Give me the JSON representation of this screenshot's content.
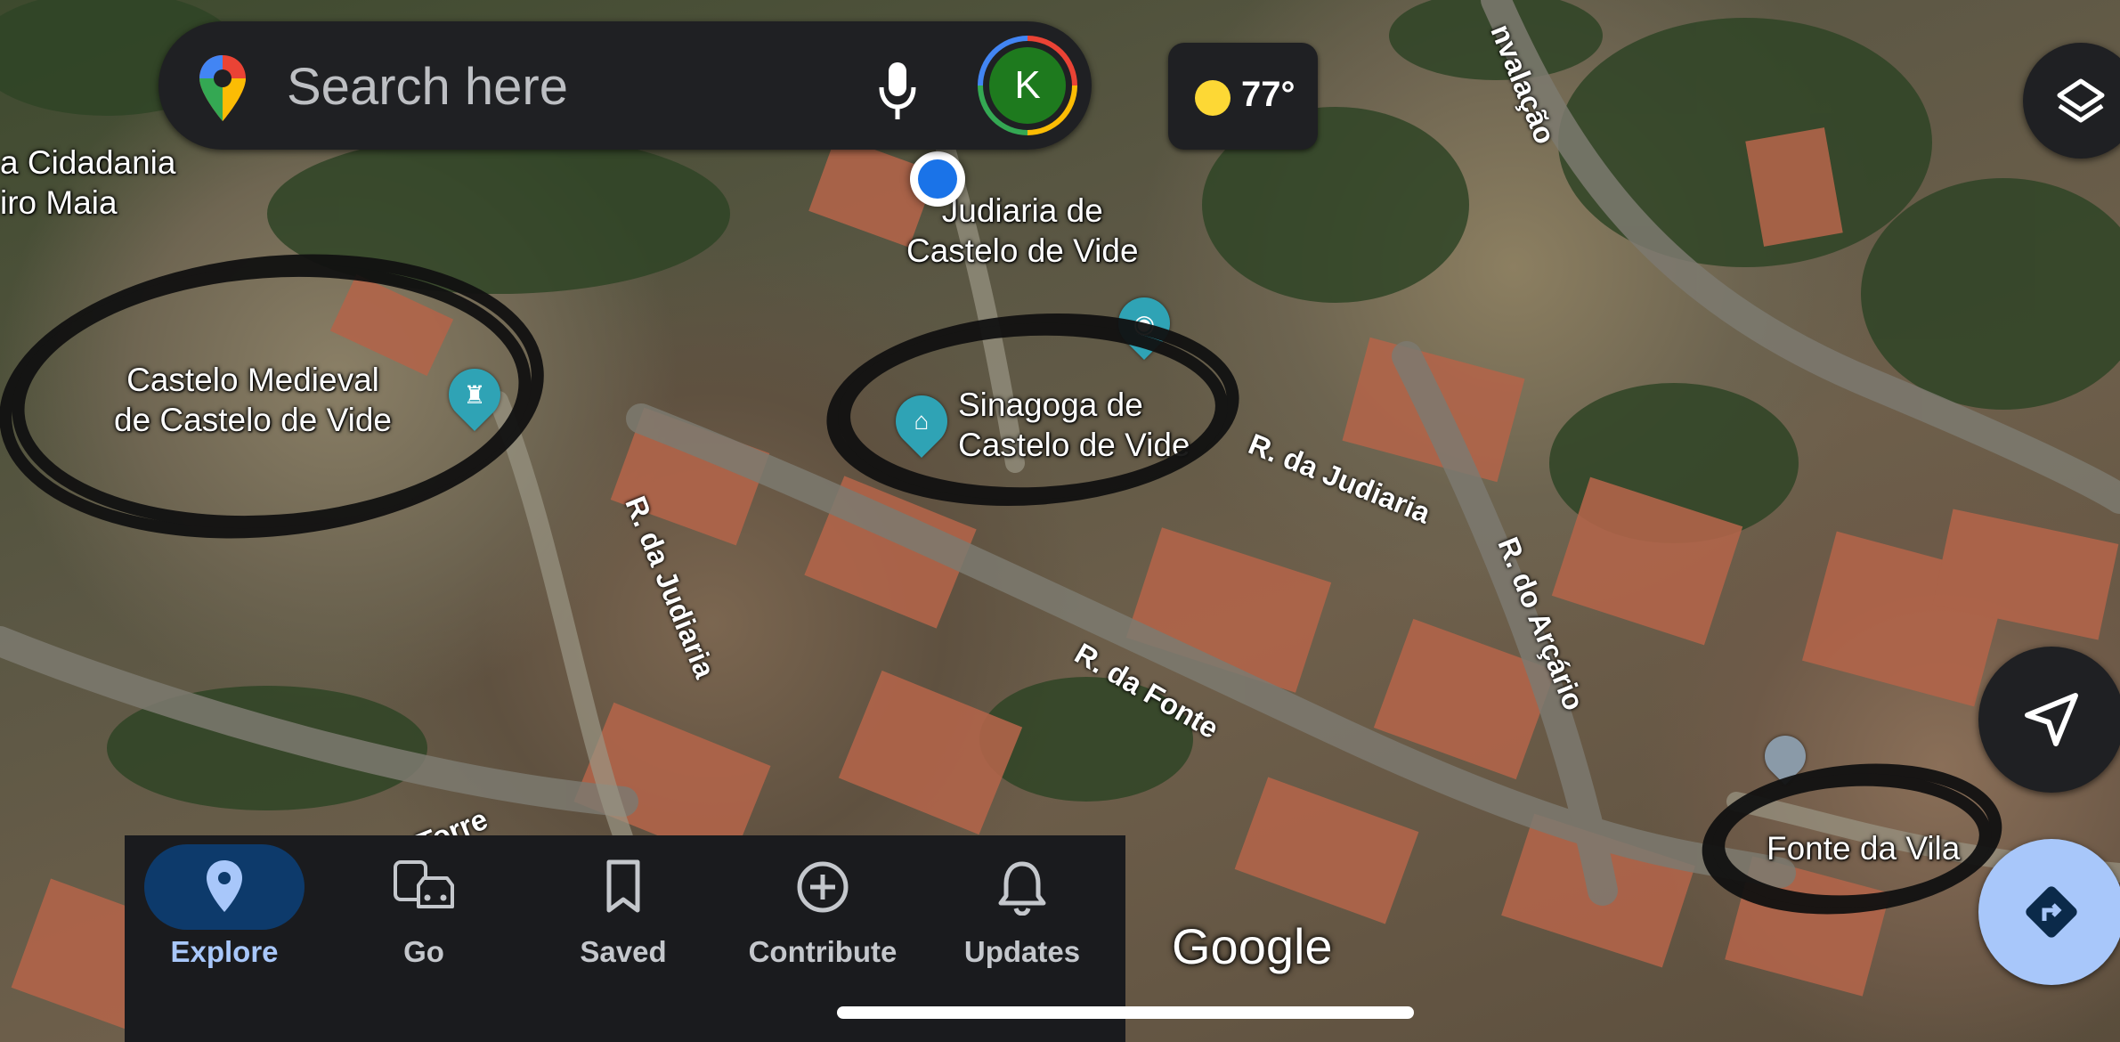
{
  "search": {
    "placeholder": "Search here",
    "avatar_initial": "K"
  },
  "weather": {
    "temperature": "77°",
    "icon": "sun-icon"
  },
  "map": {
    "places": [
      {
        "name_line1": "Castelo Medieval",
        "name_line2": "de Castelo de Vide",
        "icon": "castle-icon"
      },
      {
        "name_line1": "Sinagoga de",
        "name_line2": "Castelo de Vide",
        "icon": "museum-icon"
      },
      {
        "name_line1": "Judiaria de",
        "name_line2": "Castelo de Vide",
        "icon": "camera-icon"
      },
      {
        "name_line1": "Fonte da Vila",
        "name_line2": "",
        "icon": "place-pin-icon"
      }
    ],
    "partial_label_line1": "a Cidadania",
    "partial_label_line2": "iro Maia",
    "streets": [
      "R. da Judiaria",
      "R. da Judiaria",
      "R. do Arçário",
      "R. da Fonte",
      "nvalação",
      "Torre"
    ],
    "attribution": "Google",
    "annotation_color": "#111111",
    "accent_color": "#a8c7fa"
  },
  "nav": {
    "items": [
      {
        "label": "Explore",
        "icon": "location-pin-icon",
        "active": true
      },
      {
        "label": "Go",
        "icon": "commute-icon",
        "active": false
      },
      {
        "label": "Saved",
        "icon": "bookmark-icon",
        "active": false
      },
      {
        "label": "Contribute",
        "icon": "add-circle-icon",
        "active": false
      },
      {
        "label": "Updates",
        "icon": "bell-icon",
        "active": false
      }
    ]
  }
}
